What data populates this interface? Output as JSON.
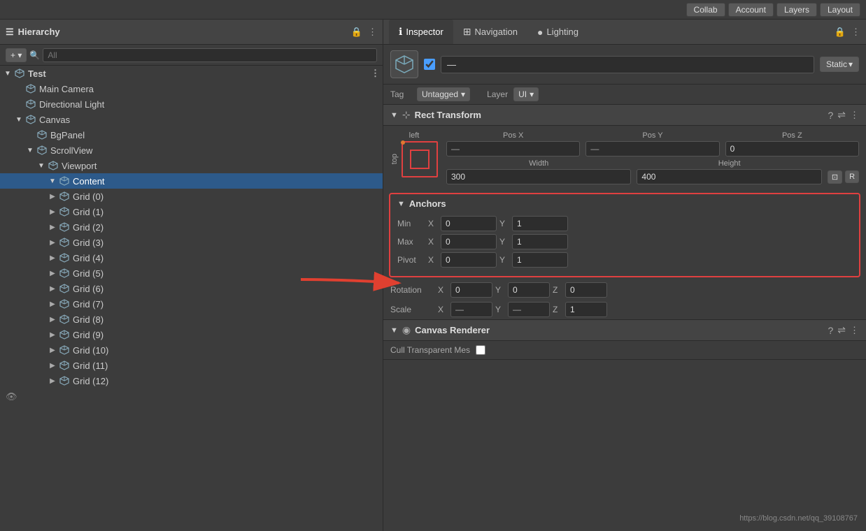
{
  "topbar": {
    "collab_label": "Collab",
    "account_label": "Account",
    "layers_label": "Layers",
    "layout_label": "Layout"
  },
  "hierarchy": {
    "title": "Hierarchy",
    "search_placeholder": "All",
    "items": [
      {
        "id": "test",
        "label": "Test",
        "indent": 0,
        "has_children": true,
        "open": true,
        "is_root": true
      },
      {
        "id": "main-camera",
        "label": "Main Camera",
        "indent": 1,
        "has_children": false
      },
      {
        "id": "directional-light",
        "label": "Directional Light",
        "indent": 1,
        "has_children": false
      },
      {
        "id": "canvas",
        "label": "Canvas",
        "indent": 1,
        "has_children": true,
        "open": true
      },
      {
        "id": "bgpanel",
        "label": "BgPanel",
        "indent": 2,
        "has_children": false
      },
      {
        "id": "scrollview",
        "label": "ScrollView",
        "indent": 2,
        "has_children": true,
        "open": true
      },
      {
        "id": "viewport",
        "label": "Viewport",
        "indent": 3,
        "has_children": true,
        "open": true
      },
      {
        "id": "content",
        "label": "Content",
        "indent": 4,
        "has_children": true,
        "open": true,
        "selected": true
      },
      {
        "id": "grid0",
        "label": "Grid (0)",
        "indent": 4,
        "has_children": true
      },
      {
        "id": "grid1",
        "label": "Grid (1)",
        "indent": 4,
        "has_children": true
      },
      {
        "id": "grid2",
        "label": "Grid (2)",
        "indent": 4,
        "has_children": true
      },
      {
        "id": "grid3",
        "label": "Grid (3)",
        "indent": 4,
        "has_children": true
      },
      {
        "id": "grid4",
        "label": "Grid (4)",
        "indent": 4,
        "has_children": true
      },
      {
        "id": "grid5",
        "label": "Grid (5)",
        "indent": 4,
        "has_children": true
      },
      {
        "id": "grid6",
        "label": "Grid (6)",
        "indent": 4,
        "has_children": true
      },
      {
        "id": "grid7",
        "label": "Grid (7)",
        "indent": 4,
        "has_children": true
      },
      {
        "id": "grid8",
        "label": "Grid (8)",
        "indent": 4,
        "has_children": true
      },
      {
        "id": "grid9",
        "label": "Grid (9)",
        "indent": 4,
        "has_children": true
      },
      {
        "id": "grid10",
        "label": "Grid (10)",
        "indent": 4,
        "has_children": true
      },
      {
        "id": "grid11",
        "label": "Grid (11)",
        "indent": 4,
        "has_children": true
      },
      {
        "id": "grid12",
        "label": "Grid (12)",
        "indent": 4,
        "has_children": true
      }
    ]
  },
  "inspector": {
    "tab_inspector": "Inspector",
    "tab_navigation": "Navigation",
    "tab_lighting": "Lighting",
    "object_name": "—",
    "static_label": "Static",
    "tag_label": "Tag",
    "tag_value": "Untagged",
    "layer_label": "Layer",
    "layer_value": "UI",
    "rect_transform": {
      "title": "Rect Transform",
      "left_label": "left",
      "top_label": "top",
      "pos_x_label": "Pos X",
      "pos_y_label": "Pos Y",
      "pos_z_label": "Pos Z",
      "pos_x_value": "—",
      "pos_y_value": "—",
      "pos_z_value": "0",
      "width_label": "Width",
      "height_label": "Height",
      "width_value": "300",
      "height_value": "400"
    },
    "anchors": {
      "title": "Anchors",
      "min_label": "Min",
      "max_label": "Max",
      "pivot_label": "Pivot",
      "min_x": "0",
      "min_y": "1",
      "max_x": "0",
      "max_y": "1",
      "pivot_x": "0",
      "pivot_y": "1"
    },
    "rotation": {
      "label": "Rotation",
      "x_label": "X",
      "y_label": "Y",
      "z_label": "Z",
      "x_value": "0",
      "y_value": "0",
      "z_value": "0"
    },
    "scale": {
      "label": "Scale",
      "x_label": "X",
      "y_label": "Y",
      "z_label": "Z",
      "x_value": "—",
      "y_value": "—",
      "z_value": "1"
    },
    "canvas_renderer": {
      "title": "Canvas Renderer",
      "cull_label": "Cull Transparent Mes"
    }
  },
  "watermark": "https://blog.csdn.net/qq_39108767"
}
